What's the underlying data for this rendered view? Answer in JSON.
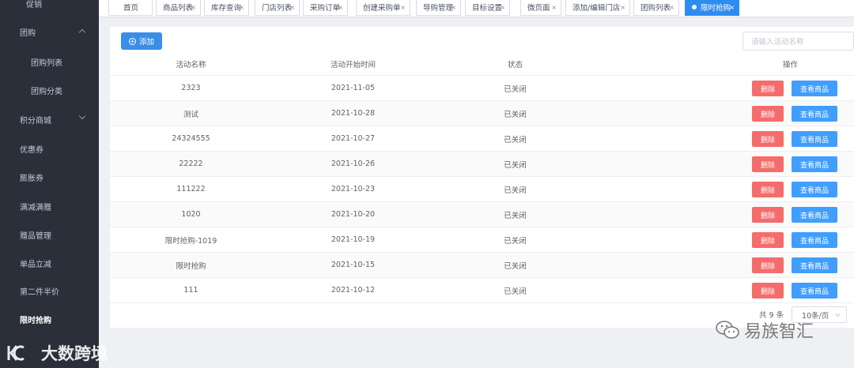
{
  "sidebar": {
    "top_label": "促销",
    "items": [
      {
        "label": "团购",
        "chevron": "up"
      },
      {
        "label": "团购列表"
      },
      {
        "label": "团购分类"
      },
      {
        "label": "积分商城",
        "chevron": "down"
      },
      {
        "label": "优惠券"
      },
      {
        "label": "膨胀券"
      },
      {
        "label": "满减满赠"
      },
      {
        "label": "赠品管理"
      },
      {
        "label": "单品立减"
      },
      {
        "label": "第二件半价"
      },
      {
        "label": "限时抢购"
      }
    ]
  },
  "tabs": [
    {
      "label": "首页"
    },
    {
      "label": "商品列表"
    },
    {
      "label": "库存查询"
    },
    {
      "label": "门店列表"
    },
    {
      "label": "采购订单"
    },
    {
      "label": "创建采购单"
    },
    {
      "label": "导购管理"
    },
    {
      "label": "目标设置"
    },
    {
      "label": "微页面"
    },
    {
      "label": "添加/编辑门店"
    },
    {
      "label": "团购列表"
    },
    {
      "label": "限时抢购"
    }
  ],
  "toolbar": {
    "add_label": "添加",
    "search_placeholder": "请输入活动名称"
  },
  "table": {
    "columns": [
      "活动名称",
      "活动开始时间",
      "状态",
      "操作"
    ],
    "rows": [
      {
        "name": "2323",
        "start": "2021-11-05",
        "status": "已关闭"
      },
      {
        "name": "测试",
        "start": "2021-10-28",
        "status": "已关闭"
      },
      {
        "name": "24324555",
        "start": "2021-10-27",
        "status": "已关闭"
      },
      {
        "name": "22222",
        "start": "2021-10-26",
        "status": "已关闭"
      },
      {
        "name": "111222",
        "start": "2021-10-23",
        "status": "已关闭"
      },
      {
        "name": "1020",
        "start": "2021-10-20",
        "status": "已关闭"
      },
      {
        "name": "限时抢购-1019",
        "start": "2021-10-19",
        "status": "已关闭"
      },
      {
        "name": "限时抢购",
        "start": "2021-10-15",
        "status": "已关闭"
      },
      {
        "name": "111",
        "start": "2021-10-12",
        "status": "已关闭"
      }
    ],
    "delete_label": "删除",
    "view_label": "查看商品"
  },
  "pager": {
    "total": "共 9 条",
    "page_size": "10条/页"
  },
  "watermarks": {
    "left": "大数跨境",
    "right": "易族智汇"
  },
  "colors": {
    "sidebar_bg": "#2b2f3a",
    "primary": "#409eff",
    "danger": "#f56c6c",
    "active_tab": "#2d8cf0"
  }
}
